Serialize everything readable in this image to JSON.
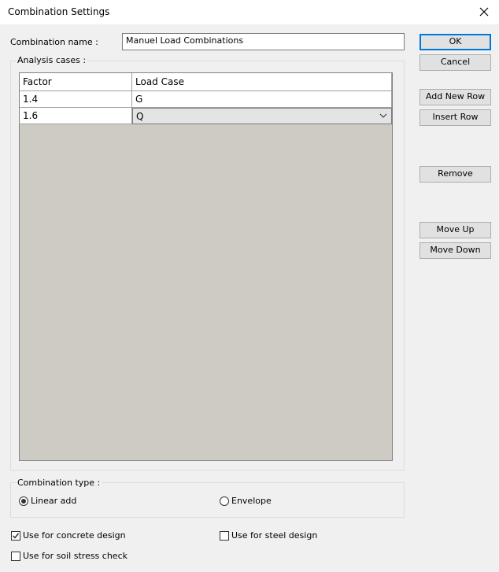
{
  "window": {
    "title": "Combination Settings",
    "close_icon": "close-icon"
  },
  "combination_name": {
    "label": "Combination name :",
    "value": "Manuel Load Combinations"
  },
  "analysis_cases": {
    "label": "Analysis cases :",
    "columns": [
      "Factor",
      "Load Case"
    ],
    "rows": [
      {
        "factor": "1.4",
        "load_case": "G"
      },
      {
        "factor": "1.6",
        "load_case": "Q"
      }
    ]
  },
  "buttons": {
    "ok": "OK",
    "cancel": "Cancel",
    "add_new_row": "Add New Row",
    "insert_row": "Insert Row",
    "remove": "Remove",
    "move_up": "Move Up",
    "move_down": "Move Down"
  },
  "combination_type": {
    "label": "Combination type :",
    "options": [
      {
        "label": "Linear add",
        "selected": true
      },
      {
        "label": "Envelope",
        "selected": false
      }
    ]
  },
  "checkboxes": {
    "concrete": {
      "label": "Use for concrete design",
      "checked": true
    },
    "steel": {
      "label": "Use for steel design",
      "checked": false
    },
    "soil": {
      "label": "Use for soil stress check",
      "checked": false
    }
  }
}
